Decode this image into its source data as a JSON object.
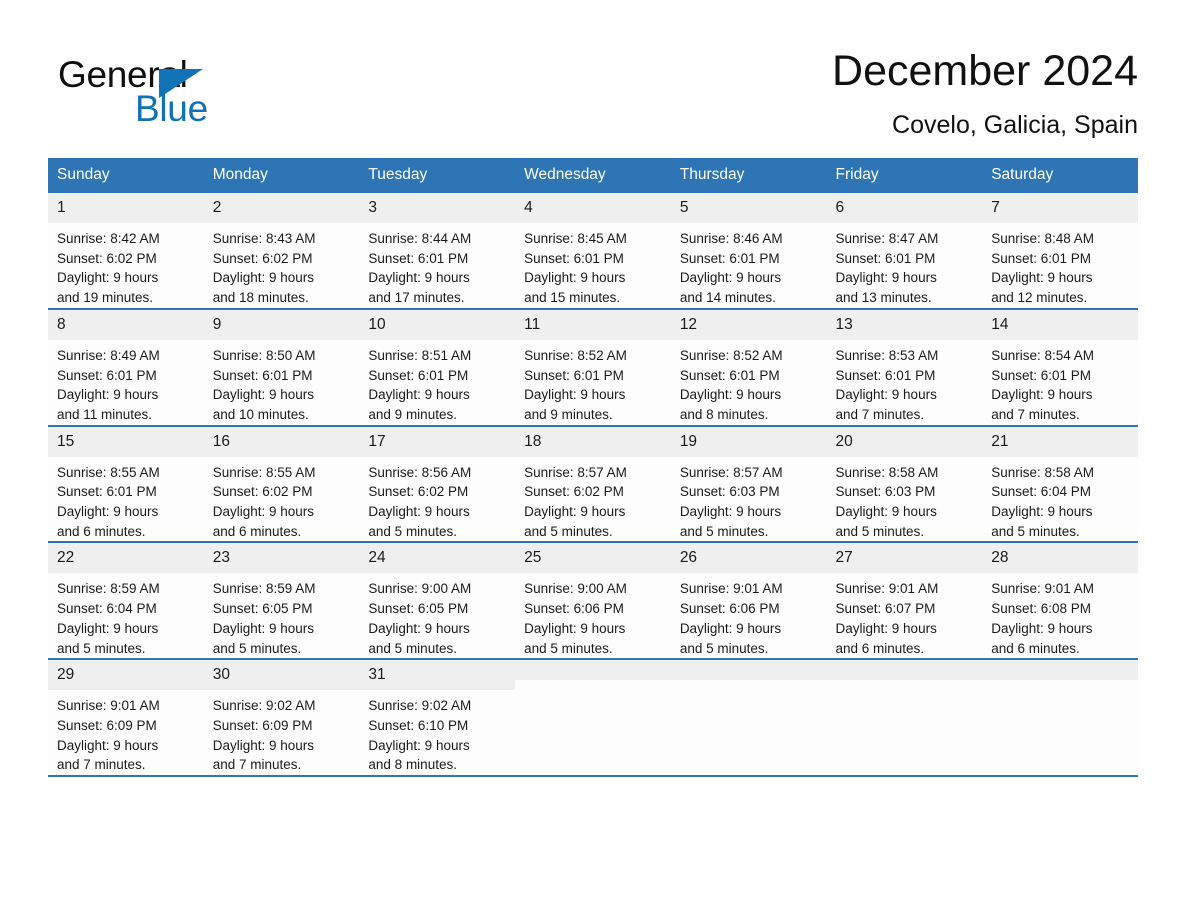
{
  "logo": {
    "word_one": "General",
    "word_two": "Blue",
    "triangle_color": "#1272b6",
    "word_one_color": "#0f0f0f",
    "word_two_color": "#1272b6"
  },
  "header": {
    "title": "December 2024",
    "location": "Covelo, Galicia, Spain"
  },
  "theme": {
    "header_blue": "#2E75B6",
    "daynum_band": "#efefef",
    "cell_background": "#fdfdfd",
    "text_color": "#1a1a1a"
  },
  "weekday_headers": [
    "Sunday",
    "Monday",
    "Tuesday",
    "Wednesday",
    "Thursday",
    "Friday",
    "Saturday"
  ],
  "weeks": [
    [
      {
        "day": "1",
        "sunrise": "Sunrise: 8:42 AM",
        "sunset": "Sunset: 6:02 PM",
        "daylight_line1": "Daylight: 9 hours",
        "daylight_line2": "and 19 minutes."
      },
      {
        "day": "2",
        "sunrise": "Sunrise: 8:43 AM",
        "sunset": "Sunset: 6:02 PM",
        "daylight_line1": "Daylight: 9 hours",
        "daylight_line2": "and 18 minutes."
      },
      {
        "day": "3",
        "sunrise": "Sunrise: 8:44 AM",
        "sunset": "Sunset: 6:01 PM",
        "daylight_line1": "Daylight: 9 hours",
        "daylight_line2": "and 17 minutes."
      },
      {
        "day": "4",
        "sunrise": "Sunrise: 8:45 AM",
        "sunset": "Sunset: 6:01 PM",
        "daylight_line1": "Daylight: 9 hours",
        "daylight_line2": "and 15 minutes."
      },
      {
        "day": "5",
        "sunrise": "Sunrise: 8:46 AM",
        "sunset": "Sunset: 6:01 PM",
        "daylight_line1": "Daylight: 9 hours",
        "daylight_line2": "and 14 minutes."
      },
      {
        "day": "6",
        "sunrise": "Sunrise: 8:47 AM",
        "sunset": "Sunset: 6:01 PM",
        "daylight_line1": "Daylight: 9 hours",
        "daylight_line2": "and 13 minutes."
      },
      {
        "day": "7",
        "sunrise": "Sunrise: 8:48 AM",
        "sunset": "Sunset: 6:01 PM",
        "daylight_line1": "Daylight: 9 hours",
        "daylight_line2": "and 12 minutes."
      }
    ],
    [
      {
        "day": "8",
        "sunrise": "Sunrise: 8:49 AM",
        "sunset": "Sunset: 6:01 PM",
        "daylight_line1": "Daylight: 9 hours",
        "daylight_line2": "and 11 minutes."
      },
      {
        "day": "9",
        "sunrise": "Sunrise: 8:50 AM",
        "sunset": "Sunset: 6:01 PM",
        "daylight_line1": "Daylight: 9 hours",
        "daylight_line2": "and 10 minutes."
      },
      {
        "day": "10",
        "sunrise": "Sunrise: 8:51 AM",
        "sunset": "Sunset: 6:01 PM",
        "daylight_line1": "Daylight: 9 hours",
        "daylight_line2": "and 9 minutes."
      },
      {
        "day": "11",
        "sunrise": "Sunrise: 8:52 AM",
        "sunset": "Sunset: 6:01 PM",
        "daylight_line1": "Daylight: 9 hours",
        "daylight_line2": "and 9 minutes."
      },
      {
        "day": "12",
        "sunrise": "Sunrise: 8:52 AM",
        "sunset": "Sunset: 6:01 PM",
        "daylight_line1": "Daylight: 9 hours",
        "daylight_line2": "and 8 minutes."
      },
      {
        "day": "13",
        "sunrise": "Sunrise: 8:53 AM",
        "sunset": "Sunset: 6:01 PM",
        "daylight_line1": "Daylight: 9 hours",
        "daylight_line2": "and 7 minutes."
      },
      {
        "day": "14",
        "sunrise": "Sunrise: 8:54 AM",
        "sunset": "Sunset: 6:01 PM",
        "daylight_line1": "Daylight: 9 hours",
        "daylight_line2": "and 7 minutes."
      }
    ],
    [
      {
        "day": "15",
        "sunrise": "Sunrise: 8:55 AM",
        "sunset": "Sunset: 6:01 PM",
        "daylight_line1": "Daylight: 9 hours",
        "daylight_line2": "and 6 minutes."
      },
      {
        "day": "16",
        "sunrise": "Sunrise: 8:55 AM",
        "sunset": "Sunset: 6:02 PM",
        "daylight_line1": "Daylight: 9 hours",
        "daylight_line2": "and 6 minutes."
      },
      {
        "day": "17",
        "sunrise": "Sunrise: 8:56 AM",
        "sunset": "Sunset: 6:02 PM",
        "daylight_line1": "Daylight: 9 hours",
        "daylight_line2": "and 5 minutes."
      },
      {
        "day": "18",
        "sunrise": "Sunrise: 8:57 AM",
        "sunset": "Sunset: 6:02 PM",
        "daylight_line1": "Daylight: 9 hours",
        "daylight_line2": "and 5 minutes."
      },
      {
        "day": "19",
        "sunrise": "Sunrise: 8:57 AM",
        "sunset": "Sunset: 6:03 PM",
        "daylight_line1": "Daylight: 9 hours",
        "daylight_line2": "and 5 minutes."
      },
      {
        "day": "20",
        "sunrise": "Sunrise: 8:58 AM",
        "sunset": "Sunset: 6:03 PM",
        "daylight_line1": "Daylight: 9 hours",
        "daylight_line2": "and 5 minutes."
      },
      {
        "day": "21",
        "sunrise": "Sunrise: 8:58 AM",
        "sunset": "Sunset: 6:04 PM",
        "daylight_line1": "Daylight: 9 hours",
        "daylight_line2": "and 5 minutes."
      }
    ],
    [
      {
        "day": "22",
        "sunrise": "Sunrise: 8:59 AM",
        "sunset": "Sunset: 6:04 PM",
        "daylight_line1": "Daylight: 9 hours",
        "daylight_line2": "and 5 minutes."
      },
      {
        "day": "23",
        "sunrise": "Sunrise: 8:59 AM",
        "sunset": "Sunset: 6:05 PM",
        "daylight_line1": "Daylight: 9 hours",
        "daylight_line2": "and 5 minutes."
      },
      {
        "day": "24",
        "sunrise": "Sunrise: 9:00 AM",
        "sunset": "Sunset: 6:05 PM",
        "daylight_line1": "Daylight: 9 hours",
        "daylight_line2": "and 5 minutes."
      },
      {
        "day": "25",
        "sunrise": "Sunrise: 9:00 AM",
        "sunset": "Sunset: 6:06 PM",
        "daylight_line1": "Daylight: 9 hours",
        "daylight_line2": "and 5 minutes."
      },
      {
        "day": "26",
        "sunrise": "Sunrise: 9:01 AM",
        "sunset": "Sunset: 6:06 PM",
        "daylight_line1": "Daylight: 9 hours",
        "daylight_line2": "and 5 minutes."
      },
      {
        "day": "27",
        "sunrise": "Sunrise: 9:01 AM",
        "sunset": "Sunset: 6:07 PM",
        "daylight_line1": "Daylight: 9 hours",
        "daylight_line2": "and 6 minutes."
      },
      {
        "day": "28",
        "sunrise": "Sunrise: 9:01 AM",
        "sunset": "Sunset: 6:08 PM",
        "daylight_line1": "Daylight: 9 hours",
        "daylight_line2": "and 6 minutes."
      }
    ],
    [
      {
        "day": "29",
        "sunrise": "Sunrise: 9:01 AM",
        "sunset": "Sunset: 6:09 PM",
        "daylight_line1": "Daylight: 9 hours",
        "daylight_line2": "and 7 minutes."
      },
      {
        "day": "30",
        "sunrise": "Sunrise: 9:02 AM",
        "sunset": "Sunset: 6:09 PM",
        "daylight_line1": "Daylight: 9 hours",
        "daylight_line2": "and 7 minutes."
      },
      {
        "day": "31",
        "sunrise": "Sunrise: 9:02 AM",
        "sunset": "Sunset: 6:10 PM",
        "daylight_line1": "Daylight: 9 hours",
        "daylight_line2": "and 8 minutes."
      },
      {
        "day": "",
        "sunrise": "",
        "sunset": "",
        "daylight_line1": "",
        "daylight_line2": ""
      },
      {
        "day": "",
        "sunrise": "",
        "sunset": "",
        "daylight_line1": "",
        "daylight_line2": ""
      },
      {
        "day": "",
        "sunrise": "",
        "sunset": "",
        "daylight_line1": "",
        "daylight_line2": ""
      },
      {
        "day": "",
        "sunrise": "",
        "sunset": "",
        "daylight_line1": "",
        "daylight_line2": ""
      }
    ]
  ]
}
